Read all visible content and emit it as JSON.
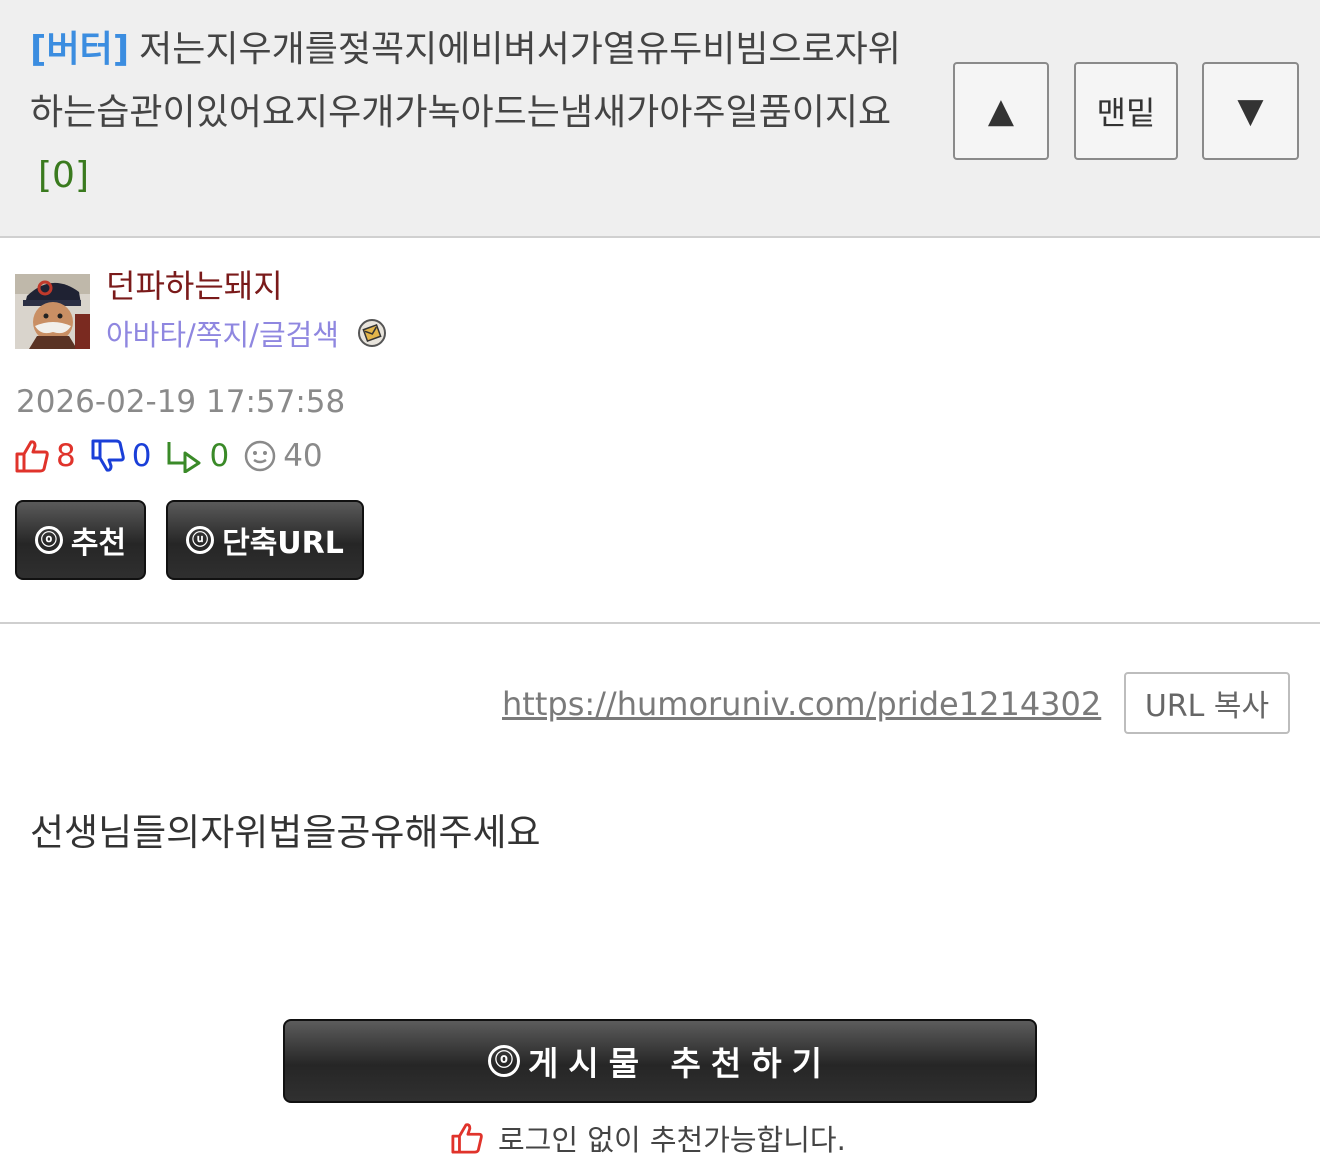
{
  "post": {
    "category": "[버터]",
    "title": "저는지우개를젖꼭지에비벼서가열유두비빔으로자위하는습관이있어요지우개가녹아드는냄새가아주일품이지요",
    "comment_count": "[0]"
  },
  "nav": {
    "up_label": "▲",
    "bottom_label": "맨밑",
    "down_label": "▼"
  },
  "author": {
    "nickname": "던파하는돼지",
    "links": "아바타/쪽지/글검색"
  },
  "meta": {
    "date": "2026-02-19 17:57:58",
    "upvotes": "8",
    "downvotes": "0",
    "replies": "0",
    "views": "40"
  },
  "buttons": {
    "recommend_icon": "ⓞ",
    "recommend_label": "추천",
    "shorturl_icon": "ⓤ",
    "shorturl_label": "단축URL"
  },
  "url": {
    "link": "https://humoruniv.com/pride1214302",
    "copy_label": "URL 복사"
  },
  "body": {
    "text": "선생님들의자위법을공유해주세요"
  },
  "footer": {
    "big_icon": "ⓞ",
    "big_label": "게시물 추천하기",
    "note": "로그인 없이 추천가능합니다."
  },
  "colors": {
    "category": "#3b8de0",
    "comment_count": "#3a7a1e",
    "nickname": "#7a1a1a",
    "links": "#8f87e0",
    "upvote": "#e0332b",
    "downvote": "#1a3fd8",
    "reply": "#3a8a28"
  },
  "icons": {
    "thumbs_up": "thumbs-up-icon",
    "thumbs_down": "thumbs-down-icon",
    "reply": "reply-arrow-icon",
    "views": "smiley-face-icon",
    "links_badge": "envelope-badge-icon"
  }
}
